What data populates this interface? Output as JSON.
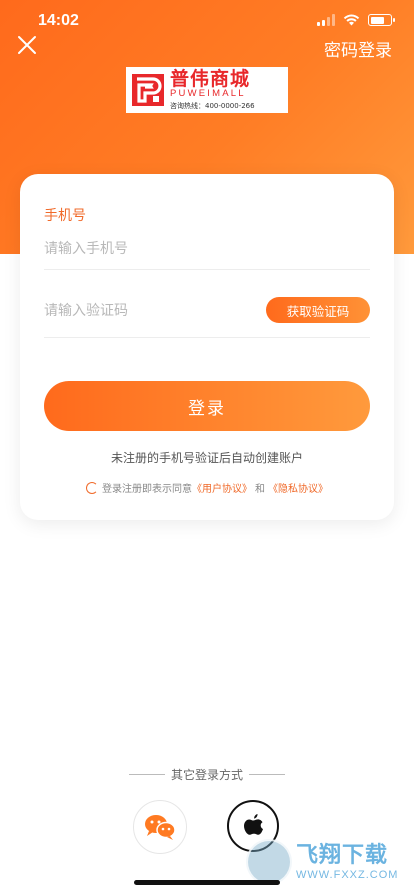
{
  "status": {
    "time": "14:02"
  },
  "header": {
    "password_login": "密码登录"
  },
  "logo": {
    "name_cn": "普伟商城",
    "name_en": "PUWEIMALL",
    "hotline": "咨询热线：400-0000-266"
  },
  "form": {
    "phone_label": "手机号",
    "phone_placeholder": "请输入手机号",
    "code_placeholder": "请输入验证码",
    "get_code": "获取验证码",
    "login": "登录",
    "auto_register_note": "未注册的手机号验证后自动创建账户",
    "agree_prefix": "登录注册即表示同意",
    "user_agreement": "《用户协议》",
    "agree_and": "和",
    "privacy_agreement": "《隐私协议》"
  },
  "other_login": {
    "label": "其它登录方式"
  },
  "watermark": {
    "name_cn": "飞翔下载",
    "domain": "WWW.FXXZ.COM"
  },
  "colors": {
    "accent": "#ff6a1c",
    "accent_light": "#ff9a3c",
    "logo_red": "#e8282b"
  }
}
